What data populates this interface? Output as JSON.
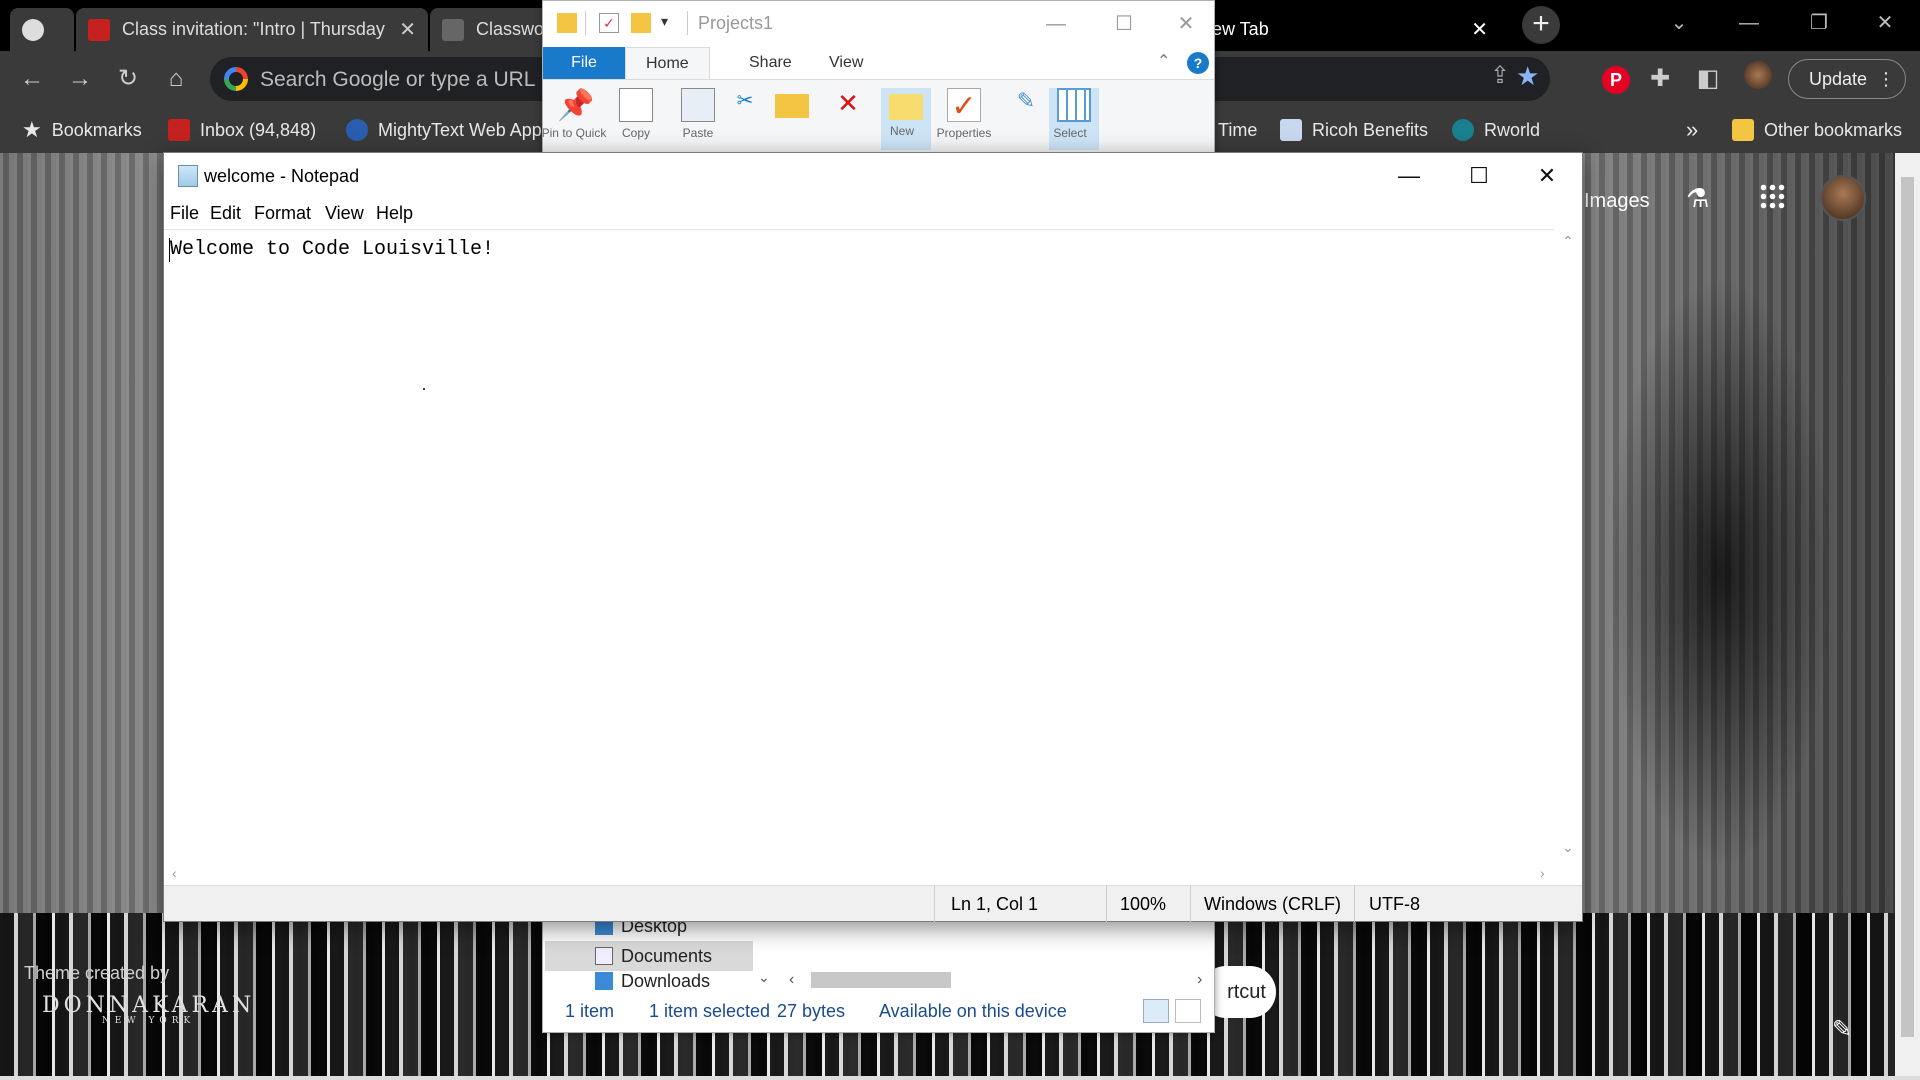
{
  "chrome": {
    "tabs": [
      {
        "label": ""
      },
      {
        "label": "Class invitation: \"Intro | Thursday"
      },
      {
        "label": "Classwo"
      },
      {
        "label": "ew Tab"
      }
    ],
    "omnibox_placeholder": "Search Google or type a URL",
    "update_label": "Update",
    "bookmarks": [
      {
        "label": "Bookmarks"
      },
      {
        "label": "Inbox (94,848)"
      },
      {
        "label": "MightyText Web App"
      },
      {
        "label": "Time"
      },
      {
        "label": "Ricoh Benefits"
      },
      {
        "label": "Rworld"
      }
    ],
    "bookmarks_overflow": "»",
    "other_bookmarks": "Other bookmarks",
    "ntp": {
      "images_link": "Images",
      "theme_credit": "Theme created by",
      "theme_logo": "DONNAKARAN",
      "theme_logo_sub": "NEW YORK",
      "shortcut_label": "rtcut"
    }
  },
  "explorer": {
    "title": "Projects1",
    "ribbon_tabs": {
      "file": "File",
      "home": "Home",
      "share": "Share",
      "view": "View"
    },
    "ribbon_buttons": [
      {
        "label": "Pin to Quick"
      },
      {
        "label": "Copy"
      },
      {
        "label": "Paste"
      },
      {
        "label": "New"
      },
      {
        "label": "Properties"
      },
      {
        "label": "Select"
      }
    ],
    "nav_items": [
      {
        "label": "Desktop"
      },
      {
        "label": "Documents"
      },
      {
        "label": "Downloads"
      }
    ],
    "status": {
      "items": "1 item",
      "selected": "1 item selected",
      "size": "27 bytes",
      "availability": "Available on this device"
    }
  },
  "notepad": {
    "title": "welcome - Notepad",
    "menu": {
      "file": "File",
      "edit": "Edit",
      "format": "Format",
      "view": "View",
      "help": "Help"
    },
    "content": "Welcome to Code Louisville!",
    "status": {
      "position": "Ln 1, Col 1",
      "zoom": "100%",
      "line_ending": "Windows (CRLF)",
      "encoding": "UTF-8"
    }
  }
}
